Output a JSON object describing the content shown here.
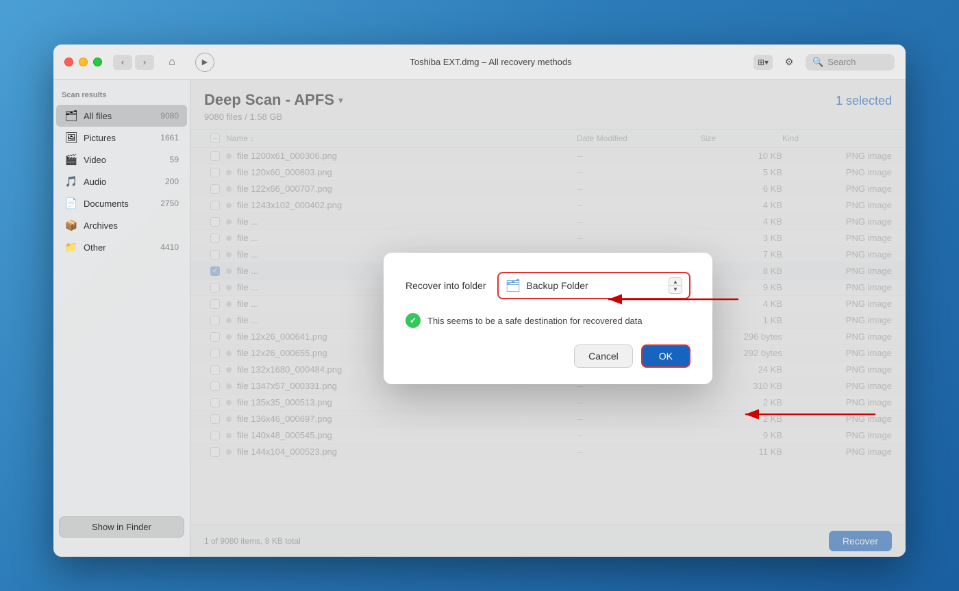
{
  "window": {
    "title": "Toshiba EXT.dmg – All recovery methods"
  },
  "titlebar": {
    "back_label": "‹",
    "forward_label": "›",
    "home_label": "⌂",
    "play_label": "▶",
    "search_placeholder": "Search",
    "view_icon": "⊞",
    "filter_icon": "⚙"
  },
  "sidebar": {
    "scan_results_label": "Scan results",
    "show_finder_label": "Show in Finder",
    "items": [
      {
        "icon": "🗂",
        "label": "All files",
        "count": "9080",
        "active": true
      },
      {
        "icon": "🖼",
        "label": "Pictures",
        "count": "1661",
        "active": false
      },
      {
        "icon": "🎬",
        "label": "Video",
        "count": "59",
        "active": false
      },
      {
        "icon": "🎵",
        "label": "Audio",
        "count": "200",
        "active": false
      },
      {
        "icon": "📄",
        "label": "Documents",
        "count": "2750",
        "active": false
      },
      {
        "icon": "📦",
        "label": "Archives",
        "count": "",
        "active": false
      },
      {
        "icon": "📁",
        "label": "Other",
        "count": "4410",
        "active": false
      }
    ]
  },
  "content": {
    "scan_title": "Deep Scan - APFS",
    "scan_subtitle": "9080 files / 1.58 GB",
    "selected_label": "1 selected",
    "columns": {
      "name": "Name",
      "date_modified": "Date Modified",
      "size": "Size",
      "kind": "Kind"
    },
    "files": [
      {
        "name": "file 1200x61_000306.png",
        "date": "--",
        "size": "10 KB",
        "kind": "PNG image",
        "checked": false
      },
      {
        "name": "file 120x60_000603.png",
        "date": "--",
        "size": "5 KB",
        "kind": "PNG image",
        "checked": false
      },
      {
        "name": "file 122x66_000707.png",
        "date": "--",
        "size": "6 KB",
        "kind": "PNG image",
        "checked": false
      },
      {
        "name": "file 1243x102_000402.png",
        "date": "--",
        "size": "4 KB",
        "kind": "PNG image",
        "checked": false
      },
      {
        "name": "file ...",
        "date": "--",
        "size": "4 KB",
        "kind": "PNG image",
        "checked": false
      },
      {
        "name": "file ...",
        "date": "--",
        "size": "3 KB",
        "kind": "PNG image",
        "checked": false
      },
      {
        "name": "file ...",
        "date": "--",
        "size": "7 KB",
        "kind": "PNG image",
        "checked": false
      },
      {
        "name": "file ...",
        "date": "--",
        "size": "8 KB",
        "kind": "PNG image",
        "checked": true
      },
      {
        "name": "file ...",
        "date": "--",
        "size": "9 KB",
        "kind": "PNG image",
        "checked": false
      },
      {
        "name": "file ...",
        "date": "--",
        "size": "4 KB",
        "kind": "PNG image",
        "checked": false
      },
      {
        "name": "file ...",
        "date": "--",
        "size": "1 KB",
        "kind": "PNG image",
        "checked": false
      },
      {
        "name": "file 12x26_000641.png",
        "date": "--",
        "size": "296 bytes",
        "kind": "PNG image",
        "checked": false
      },
      {
        "name": "file 12x26_000655.png",
        "date": "--",
        "size": "292 bytes",
        "kind": "PNG image",
        "checked": false
      },
      {
        "name": "file 132x1680_000484.png",
        "date": "--",
        "size": "24 KB",
        "kind": "PNG image",
        "checked": false
      },
      {
        "name": "file 1347x57_000331.png",
        "date": "--",
        "size": "310 KB",
        "kind": "PNG image",
        "checked": false
      },
      {
        "name": "file 135x35_000513.png",
        "date": "--",
        "size": "2 KB",
        "kind": "PNG image",
        "checked": false
      },
      {
        "name": "file 136x46_000697.png",
        "date": "--",
        "size": "2 KB",
        "kind": "PNG image",
        "checked": false
      },
      {
        "name": "file 140x48_000545.png",
        "date": "--",
        "size": "9 KB",
        "kind": "PNG image",
        "checked": false
      },
      {
        "name": "file 144x104_000523.png",
        "date": "--",
        "size": "11 KB",
        "kind": "PNG image",
        "checked": false
      }
    ],
    "footer_info": "1 of 9080 items, 8 KB total",
    "recover_label": "Recover"
  },
  "modal": {
    "title": "Recover into folder",
    "folder_icon": "🗂",
    "folder_name": "Backup Folder",
    "safe_message": "This seems to be a safe destination for recovered data",
    "cancel_label": "Cancel",
    "ok_label": "OK"
  }
}
